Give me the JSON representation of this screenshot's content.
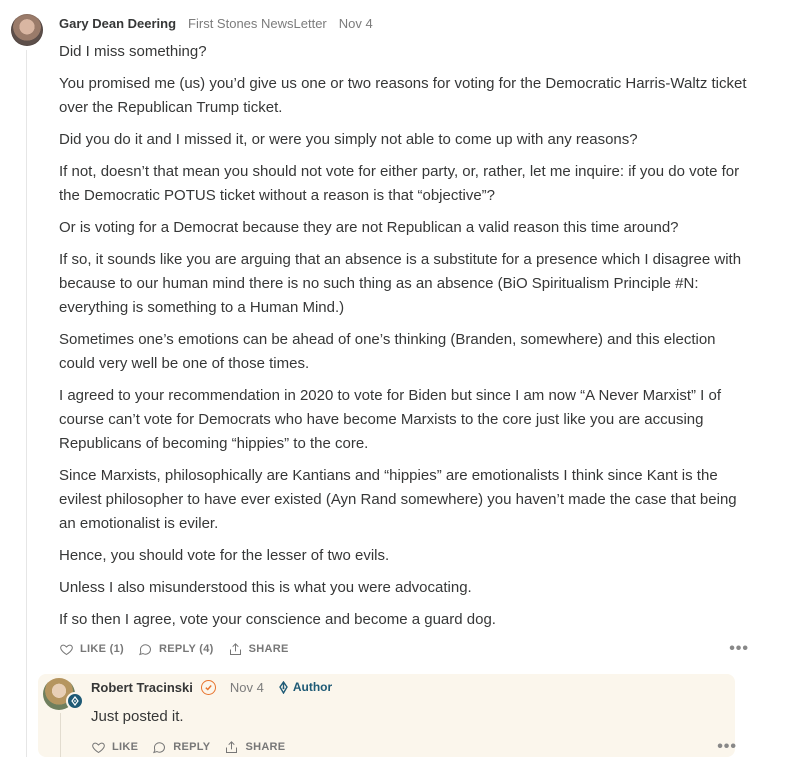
{
  "comment": {
    "author": "Gary Dean Deering",
    "publication": "First Stones NewsLetter",
    "date": "Nov 4",
    "paragraphs": [
      "Did I miss something?",
      "You promised me (us) you’d give us one or two reasons for voting for the Democratic Harris-Waltz ticket over the Republican Trump ticket.",
      "Did you do it and I missed it, or were you simply not able to come up with any reasons?",
      "If not, doesn’t that mean you should not vote for either party, or, rather, let me inquire: if you do vote for the Democratic POTUS ticket without a reason is that “objective”?",
      "Or is voting for a Democrat because they are not Republican a valid reason this time around?",
      "If so, it sounds like you are arguing that an absence is a substitute for a presence which I disagree with because to our human mind there is no such thing as an absence (BiO Spiritualism Principle #N: everything is something to a Human Mind.)",
      "Sometimes one’s emotions can be ahead of one’s thinking (Branden, somewhere) and this election could very well be one of those times.",
      "I agreed to your recommendation in 2020 to vote for Biden but since I am now “A Never Marxist” I of course can’t vote for Democrats who have become Marxists to the core just like you are accusing Republicans of becoming “hippies” to the core.",
      "Since Marxists, philosophically are Kantians and “hippies” are emotionalists I think since Kant is the evilest philosopher to have ever existed (Ayn Rand somewhere) you haven’t made the case that being an emotionalist is eviler.",
      "Hence, you should vote for the lesser of two evils.",
      "Unless I also misunderstood this is what you were advocating.",
      "If so then I agree, vote your conscience and become a guard dog."
    ],
    "actions": {
      "like": "LIKE (1)",
      "reply": "REPLY (4)",
      "share": "SHARE",
      "more": "•••"
    }
  },
  "reply": {
    "author": "Robert Tracinski",
    "date": "Nov 4",
    "author_tag": "Author",
    "text": "Just posted it.",
    "actions": {
      "like": "LIKE",
      "reply": "REPLY",
      "share": "SHARE",
      "more": "•••"
    }
  },
  "colors": {
    "accent_orange": "#e8742e",
    "author_blue": "#1e5a75",
    "reply_bg": "#fbf6ec"
  },
  "icons": [
    "heart-icon",
    "speech-bubble-icon",
    "share-icon",
    "verified-check-icon",
    "pen-nib-icon",
    "more-icon"
  ]
}
